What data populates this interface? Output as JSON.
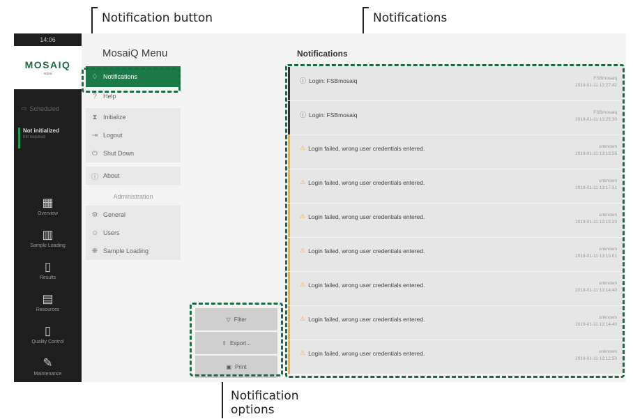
{
  "annotations": {
    "notification_button": "Notification button",
    "notifications": "Notifications",
    "notification_options_line1": "Notification",
    "notification_options_line2": "options"
  },
  "rail": {
    "time": "14:06",
    "logo": "MOSAIQ",
    "logo_sub": "sepia",
    "status_label": "Scheduled",
    "init_title": "Not initialized",
    "init_sub": "Init required",
    "items": [
      {
        "label": "Overview",
        "icon": "grid-icon",
        "glyph": "▦"
      },
      {
        "label": "Sample Loading",
        "icon": "loading-icon",
        "glyph": "▥"
      },
      {
        "label": "Results",
        "icon": "results-icon",
        "glyph": "▯"
      },
      {
        "label": "Resources",
        "icon": "resources-icon",
        "glyph": "▤"
      },
      {
        "label": "Quality Control",
        "icon": "qc-icon",
        "glyph": "▯"
      },
      {
        "label": "Maintenance",
        "icon": "wrench-icon",
        "glyph": "✎"
      }
    ]
  },
  "menu": {
    "title": "MosaiQ Menu",
    "items_top": [
      {
        "label": "Notifications",
        "icon": "bell-icon",
        "glyph": "♢",
        "active": true
      },
      {
        "label": "Help",
        "icon": "help-icon",
        "glyph": "?",
        "active": false
      }
    ],
    "items_mid": [
      {
        "label": "Initialize",
        "icon": "initialize-icon",
        "glyph": "⧗"
      },
      {
        "label": "Logout",
        "icon": "logout-icon",
        "glyph": "⇥"
      },
      {
        "label": "Shut Down",
        "icon": "power-icon",
        "glyph": "⏻"
      }
    ],
    "items_about": [
      {
        "label": "About",
        "icon": "info-icon",
        "glyph": "ⓘ"
      }
    ],
    "admin_section": "Administration",
    "items_admin": [
      {
        "label": "General",
        "icon": "settings-icon",
        "glyph": "⚙"
      },
      {
        "label": "Users",
        "icon": "users-icon",
        "glyph": "☺"
      },
      {
        "label": "Sample Loading",
        "icon": "sample-loading-icon",
        "glyph": "❋"
      }
    ]
  },
  "options": {
    "filter": "Filter",
    "export": "Export...",
    "print": "Print"
  },
  "notifications": {
    "title": "Notifications",
    "items": [
      {
        "type": "info",
        "message": "Login: FSBmosaiq",
        "user": "FSBmosaiq",
        "time": "2019-01-11 13:27:42"
      },
      {
        "type": "info",
        "message": "Login: FSBmosaiq",
        "user": "FSBmosaiq",
        "time": "2019-01-11 13:25:30"
      },
      {
        "type": "warn",
        "message": "Login failed, wrong user credentials entered.",
        "user": "unknown",
        "time": "2019-01-11 13:19:56"
      },
      {
        "type": "warn",
        "message": "Login failed, wrong user credentials entered.",
        "user": "unknown",
        "time": "2019-01-11 13:17:51"
      },
      {
        "type": "warn",
        "message": "Login failed, wrong user credentials entered.",
        "user": "unknown",
        "time": "2019-01-11 13:15:20"
      },
      {
        "type": "warn",
        "message": "Login failed, wrong user credentials entered.",
        "user": "unknown",
        "time": "2019-01-11 13:15:01"
      },
      {
        "type": "warn",
        "message": "Login failed, wrong user credentials entered.",
        "user": "unknown",
        "time": "2019-01-11 13:14:40"
      },
      {
        "type": "warn",
        "message": "Login failed, wrong user credentials entered.",
        "user": "unknown",
        "time": "2019-01-11 13:14:40"
      },
      {
        "type": "warn",
        "message": "Login failed, wrong user credentials entered.",
        "user": "unknown",
        "time": "2019-01-11 13:12:50"
      }
    ]
  }
}
